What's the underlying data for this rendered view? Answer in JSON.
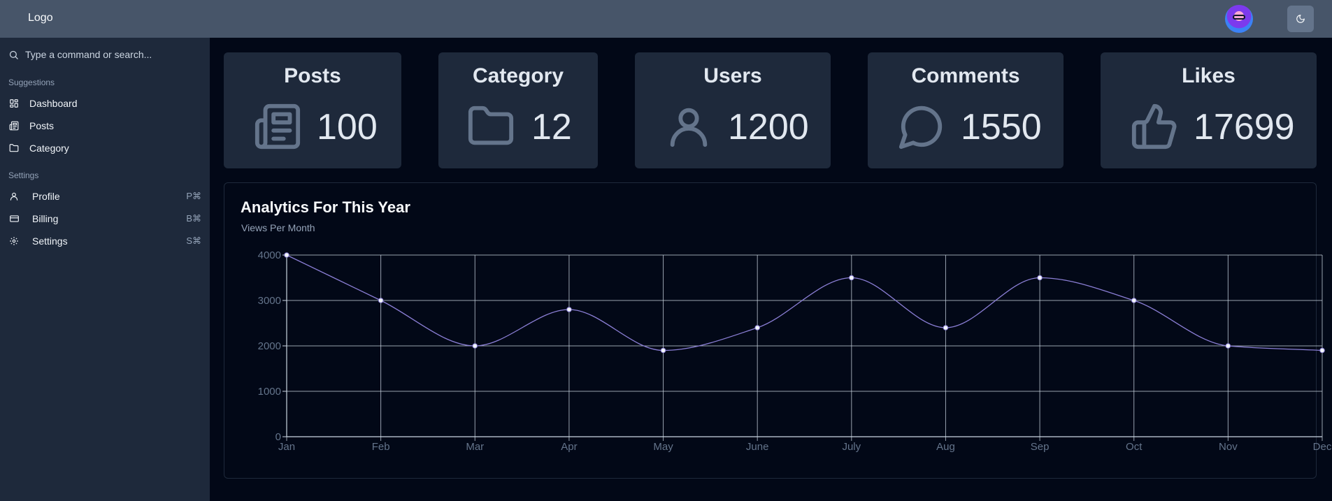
{
  "header": {
    "logo": "Logo",
    "avatar_icon": "avatar",
    "theme_icon": "moon-icon"
  },
  "sidebar": {
    "search_placeholder": "Type a command or search...",
    "suggestions_title": "Suggestions",
    "suggestions": [
      {
        "label": "Dashboard",
        "icon": "dashboard-icon"
      },
      {
        "label": "Posts",
        "icon": "newspaper-icon"
      },
      {
        "label": "Category",
        "icon": "folder-icon"
      }
    ],
    "settings_title": "Settings",
    "settings": [
      {
        "label": "Profile",
        "shortcut": "P⌘",
        "icon": "user-icon"
      },
      {
        "label": "Billing",
        "shortcut": "B⌘",
        "icon": "credit-card-icon"
      },
      {
        "label": "Settings",
        "shortcut": "S⌘",
        "icon": "gear-icon"
      }
    ]
  },
  "stats": [
    {
      "title": "Posts",
      "value": "100",
      "icon": "newspaper-icon"
    },
    {
      "title": "Category",
      "value": "12",
      "icon": "folder-icon"
    },
    {
      "title": "Users",
      "value": "1200",
      "icon": "user-icon"
    },
    {
      "title": "Comments",
      "value": "1550",
      "icon": "message-circle-icon"
    },
    {
      "title": "Likes",
      "value": "17699",
      "icon": "thumbs-up-icon"
    }
  ],
  "analytics": {
    "title": "Analytics For This Year",
    "subtitle": "Views Per Month"
  },
  "colors": {
    "topbar": "#475569",
    "sidebar": "#1e293b",
    "background": "#020817",
    "card": "#1e293b",
    "line": "#8b7fd6",
    "grid": "#cbd5e1"
  },
  "chart_data": {
    "type": "line",
    "categories": [
      "Jan",
      "Feb",
      "Mar",
      "Apr",
      "May",
      "June",
      "July",
      "Aug",
      "Sep",
      "Oct",
      "Nov",
      "Dec"
    ],
    "series": [
      {
        "values": [
          4000,
          3000,
          2000,
          2800,
          1900,
          2400,
          3500,
          2400,
          3500,
          3000,
          2000,
          1900
        ]
      }
    ],
    "ylim": [
      0,
      4000
    ],
    "yticks": [
      0,
      1000,
      2000,
      3000,
      4000
    ],
    "grid": true,
    "smooth": true
  }
}
